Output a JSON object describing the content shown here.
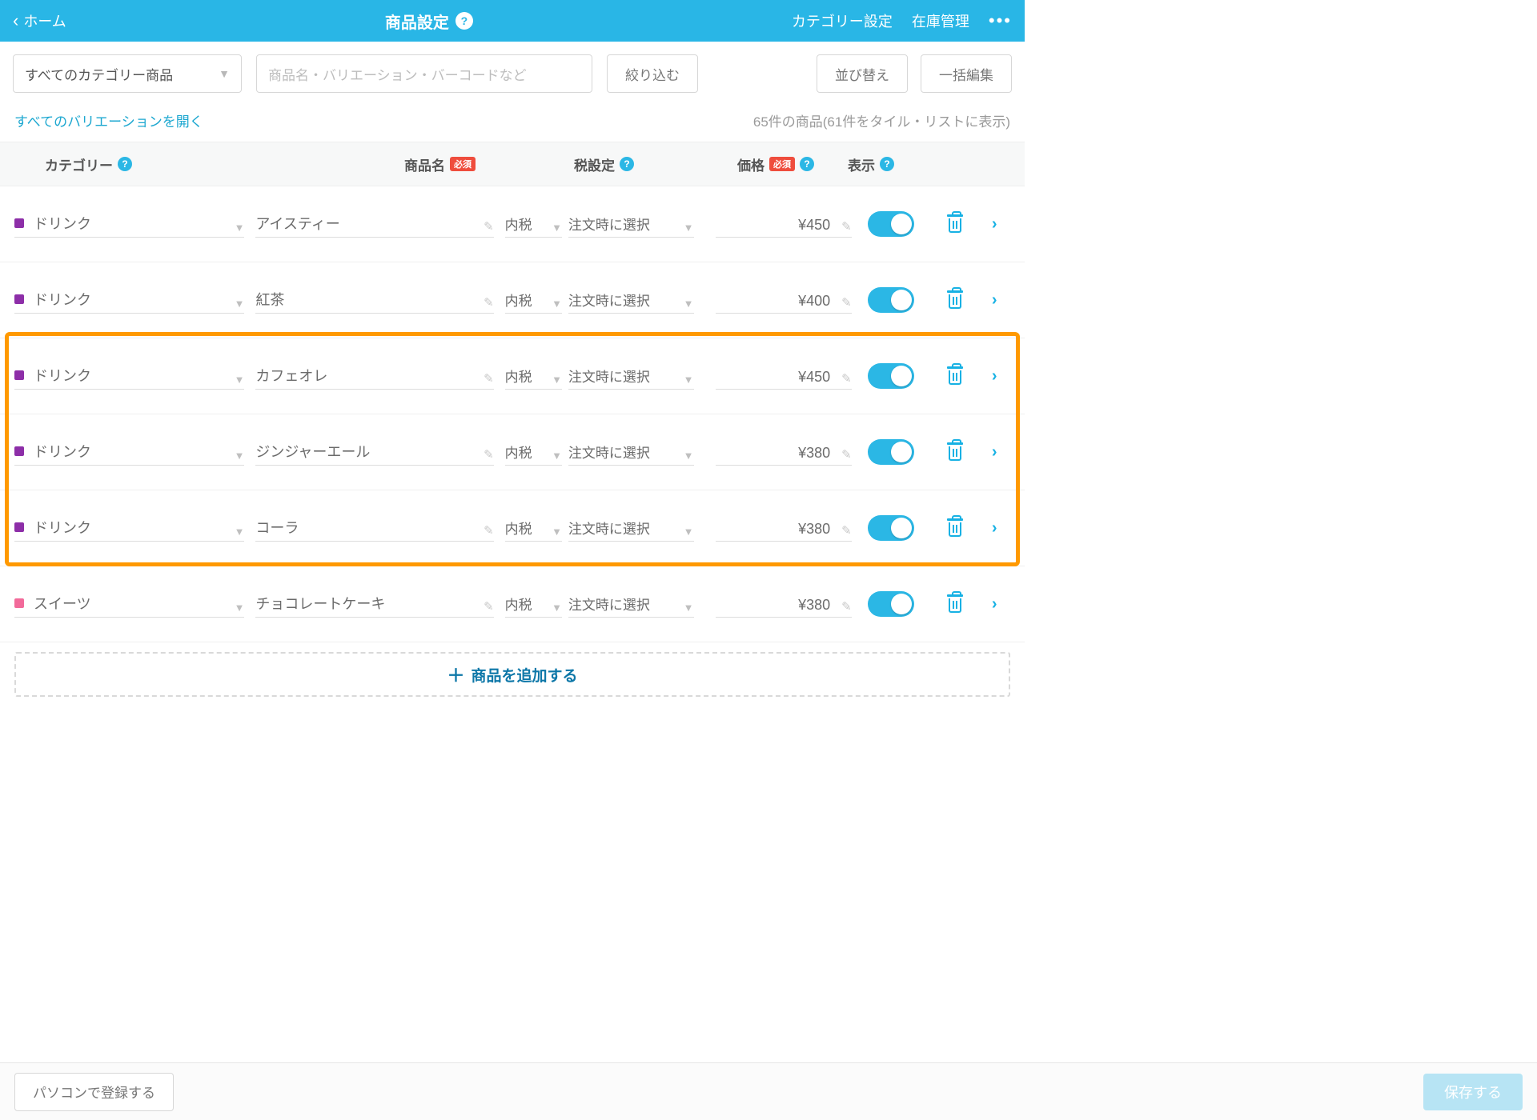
{
  "header": {
    "back": "ホーム",
    "title": "商品設定",
    "right1": "カテゴリー設定",
    "right2": "在庫管理"
  },
  "filter": {
    "category_select": "すべてのカテゴリー商品",
    "search_placeholder": "商品名・バリエーション・バーコードなど",
    "narrow": "絞り込む",
    "sort": "並び替え",
    "bulk": "一括編集"
  },
  "secondary": {
    "open_all": "すべてのバリエーションを開く",
    "count": "65件の商品(61件をタイル・リストに表示)"
  },
  "columns": {
    "category": "カテゴリー",
    "name": "商品名",
    "tax": "税設定",
    "price": "価格",
    "display": "表示",
    "required": "必須"
  },
  "rows": [
    {
      "color": "#8d2ea8",
      "category": "ドリンク",
      "name": "アイスティー",
      "tax1": "内税",
      "tax2": "注文時に選択",
      "price": "¥450",
      "display": true
    },
    {
      "color": "#8d2ea8",
      "category": "ドリンク",
      "name": "紅茶",
      "tax1": "内税",
      "tax2": "注文時に選択",
      "price": "¥400",
      "display": true
    },
    {
      "color": "#8d2ea8",
      "category": "ドリンク",
      "name": "カフェオレ",
      "tax1": "内税",
      "tax2": "注文時に選択",
      "price": "¥450",
      "display": true
    },
    {
      "color": "#8d2ea8",
      "category": "ドリンク",
      "name": "ジンジャーエール",
      "tax1": "内税",
      "tax2": "注文時に選択",
      "price": "¥380",
      "display": true
    },
    {
      "color": "#8d2ea8",
      "category": "ドリンク",
      "name": "コーラ",
      "tax1": "内税",
      "tax2": "注文時に選択",
      "price": "¥380",
      "display": true
    },
    {
      "color": "#f26a9a",
      "category": "スイーツ",
      "name": "チョコレートケーキ",
      "tax1": "内税",
      "tax2": "注文時に選択",
      "price": "¥380",
      "display": true
    }
  ],
  "highlight": {
    "startRow": 2,
    "endRow": 4
  },
  "add_row": "商品を追加する",
  "footer": {
    "pc": "パソコンで登録する",
    "save": "保存する"
  }
}
